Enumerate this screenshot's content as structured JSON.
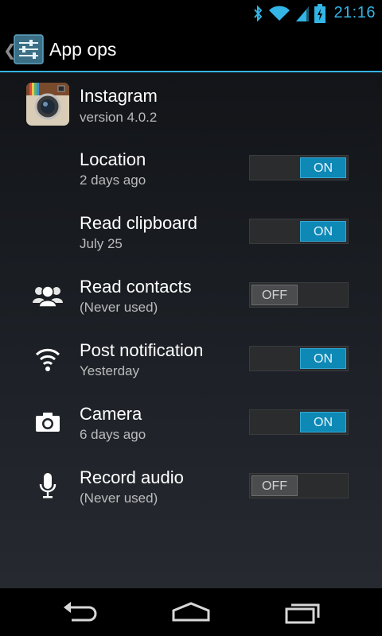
{
  "status_bar": {
    "time": "21:16",
    "icons": [
      "bluetooth-icon",
      "wifi-icon",
      "cell-signal-icon",
      "battery-charging-icon"
    ],
    "accent_color": "#33b5e5"
  },
  "action_bar": {
    "title": "App ops",
    "up_icon": "chevron-left-icon",
    "app_icon": "settings-sliders-icon"
  },
  "app": {
    "name": "Instagram",
    "version": "version 4.0.2",
    "icon": "instagram-camera-icon"
  },
  "ops": [
    {
      "title": "Location",
      "subtitle": "2 days ago",
      "state": "ON",
      "enabled": true,
      "icon": ""
    },
    {
      "title": "Read clipboard",
      "subtitle": "July 25",
      "state": "ON",
      "enabled": true,
      "icon": ""
    },
    {
      "title": "Read contacts",
      "subtitle": "(Never used)",
      "state": "OFF",
      "enabled": false,
      "icon": "contacts-icon"
    },
    {
      "title": "Post notification",
      "subtitle": "Yesterday",
      "state": "ON",
      "enabled": true,
      "icon": "wireless-icon"
    },
    {
      "title": "Camera",
      "subtitle": "6 days ago",
      "state": "ON",
      "enabled": true,
      "icon": "camera-icon"
    },
    {
      "title": "Record audio",
      "subtitle": "(Never used)",
      "state": "OFF",
      "enabled": false,
      "icon": "microphone-icon"
    }
  ],
  "nav_bar": {
    "buttons": [
      "back-icon",
      "home-icon",
      "recent-apps-icon"
    ]
  }
}
